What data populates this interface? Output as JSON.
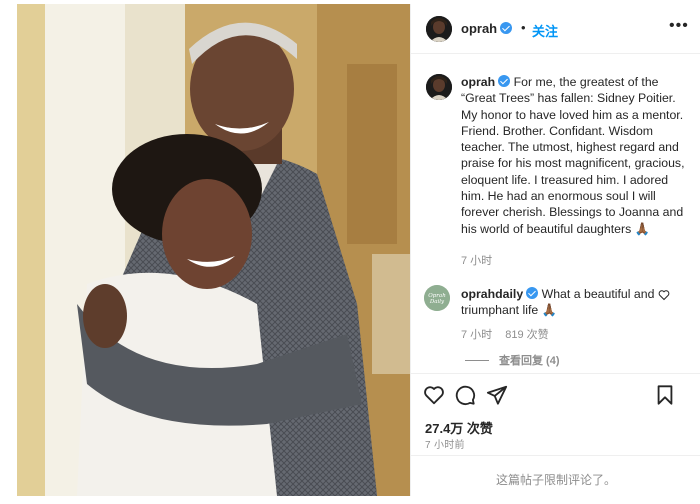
{
  "post": {
    "username": "oprah",
    "follow_label": "关注",
    "more_label": "•••",
    "dot": "•",
    "caption_username": "oprah",
    "caption_text": "For me, the greatest of the “Great Trees” has fallen: Sidney Poitier. My honor to have loved him as a mentor. Friend. Brother. Confidant. Wisdom teacher. The utmost, highest regard and praise for his most magnificent, gracious, eloquent life. I treasured him. I adored him. He had an enormous soul I will forever cherish. Blessings to Joanna and his world of beautiful daughters 🙏🏾",
    "caption_time": "7 小时",
    "avatar_logo_text": "Oprah Daily"
  },
  "comment": {
    "username": "oprahdaily",
    "text": "What a beautiful and triumphant life 🙏🏾",
    "time": "7 小时",
    "likes": "819 次赞",
    "reply_label": "",
    "view_replies": "查看回复 (4)"
  },
  "actions": {
    "icons": [
      "heart-icon",
      "comment-icon",
      "share-icon",
      "bookmark-icon"
    ]
  },
  "stats": {
    "likes": "27.4万 次赞",
    "time_ago": "7 小时前"
  },
  "footer": {
    "comments_limited": "这篇帖子限制评论了。"
  },
  "colors": {
    "accent": "#0095f6",
    "verified": "#3897f0",
    "muted": "#8e8e8e",
    "border": "#efefef"
  }
}
